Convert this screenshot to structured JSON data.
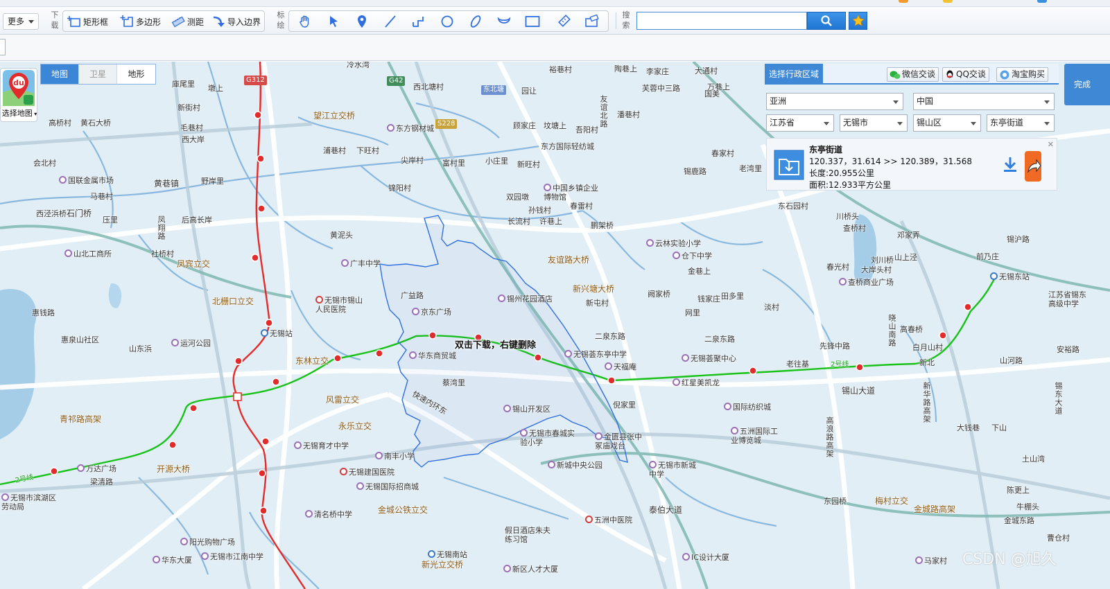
{
  "toolbar": {
    "more_label": "更多",
    "download_group_label": "下载",
    "rect_label": "矩形框",
    "polygon_label": "多边形",
    "measure_label": "测距",
    "import_label": "导入边界",
    "mark_group_label": "标绘",
    "search_group_label": "搜索",
    "search_value": "",
    "search_placeholder": ""
  },
  "map_type": {
    "map": "地图",
    "satellite": "卫星",
    "terrain": "地形",
    "active": "地图"
  },
  "choose_map_label": "选择地图",
  "admin": {
    "title": "选择行政区域",
    "wechat": "微信交谈",
    "qq": "QQ交谈",
    "taobao": "淘宝购买",
    "continent": "亚洲",
    "country": "中国",
    "province": "江苏省",
    "city": "无锡市",
    "district": "锡山区",
    "street": "东亭街道"
  },
  "result": {
    "name": "东亭街道",
    "coords": "120.337，31.614 >> 120.389，31.568",
    "length": "长度:20.955公里",
    "area": "面积:12.933平方公里"
  },
  "finish_label": "完成",
  "map_hint": "双击下载，右键删除",
  "watermark": "CSDN @旭久",
  "road_tags": {
    "g312": "G312",
    "g42": "G42",
    "s228": "S228",
    "east_north_pond": "东北塘"
  },
  "colors": {
    "accent": "#3e88d6",
    "metro_red": "#e22b2b",
    "metro_green": "#19c219",
    "boundary": "#2f6fe0"
  },
  "labels": [
    "冷水湾",
    "裕巷村",
    "陶巷上",
    "李家庄",
    "大通村",
    "庫尾里",
    "墩上",
    "新街村",
    "毛巷村",
    "西大岸",
    "高桥村",
    "黄石大桥",
    "会北村",
    "国联金属市场",
    "黄巷镇",
    "野岸里",
    "马巷村",
    "西泾浜桥",
    "石门桥",
    "压里",
    "凤翔路",
    "后高长岸",
    "山北工商所",
    "社桥村",
    "凤宾立交",
    "北栅口立交",
    "惠钱路",
    "惠泉山社区",
    "山东浜",
    "运河公园",
    "无锡站",
    "东林立交",
    "风雷立交",
    "永乐立交",
    "青祁路高架",
    "开源大桥",
    "万达广场",
    "梁清路",
    "无锡市滨湖区劳动局",
    "阳光购物广场",
    "华东大厦",
    "无锡市江南中学",
    "清名桥中学",
    "无锡育才中学",
    "南丰小学",
    "无锡建国医院",
    "无锡国际招商城",
    "金城公铁立交",
    "无锡南站",
    "新光立交桥",
    "望江立交桥",
    "东方钢材城",
    "西北塘村",
    "园让",
    "顾家庄",
    "坟塘上",
    "吾阳村",
    "东方国际轻纺城",
    "浦巷村",
    "下旺村",
    "尖岸村",
    "富村里",
    "小庄里",
    "新旺村",
    "锦阳村",
    "中国乡镇企业博物馆",
    "双园墩",
    "孙钱村",
    "春雷村",
    "长流村",
    "许巷上",
    "鹏架桥",
    "黄泥头",
    "广丰中学",
    "无锡市锡山人民医院",
    "广益路",
    "京东广场",
    "锡州花园酒店",
    "友谊路大桥",
    "新兴塘大桥",
    "新屯村",
    "二泉东路",
    "无锡荟东亭中学",
    "天福庵",
    "无锡荟聚中心",
    "红星美凯龙",
    "华东商贸城",
    "蔡湾里",
    "快速内环东",
    "锡山开发区",
    "无锡市春城实验小学",
    "金匮县张中冢庙戏台",
    "新城中央公园",
    "无锡市新城中学",
    "五洲中医院",
    "泰伯大道",
    "倪家里",
    "国际纺织城",
    "五洲国际工业博览城",
    "IC设计大厦",
    "新区人才大厦",
    "假日酒店朱夫练习馆",
    "芙蓉中三路",
    "万巷上",
    "潘巷村",
    "友谊北路",
    "春家村",
    "锡鹿路",
    "老湾里",
    "东石园村",
    "云林实验小学",
    "仓下中学",
    "金巷上",
    "钱家庄",
    "田多里",
    "阙家桥",
    "网里",
    "淡村",
    "二泉东路",
    "先锋中路",
    "锡山大道",
    "老往基",
    "2号线",
    "山河路",
    "白月山村",
    "高春桥",
    "晓山南路",
    "高浪路高架",
    "新华路高架",
    "东园桥",
    "梅村立交",
    "金城路高架",
    "金城东路",
    "无锡东站",
    "锡沪路",
    "川桥头",
    "查桥村",
    "邓家弄",
    "刘川桥",
    "山上泾",
    "春光村",
    "大岸头村",
    "前乃庄",
    "查桥商业广场",
    "江苏省锡东高级中学",
    "锡东大道",
    "安裕路",
    "新北",
    "大钱巷",
    "下山",
    "土山湾",
    "陈更上",
    "牛棚头",
    "曹仓村",
    "马家村",
    "国美",
    "万巷上",
    "东亭街道"
  ]
}
